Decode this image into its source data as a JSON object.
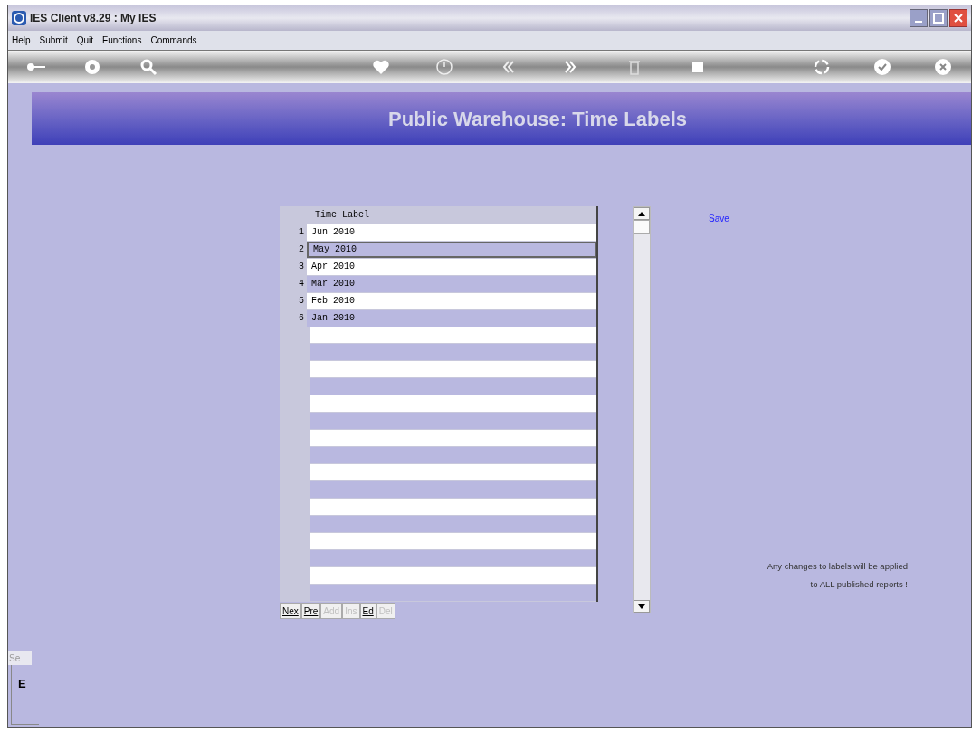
{
  "window": {
    "title": "IES Client v8.29 : My IES"
  },
  "menu": [
    "Help",
    "Submit",
    "Quit",
    "Functions",
    "Commands"
  ],
  "banner": {
    "title": "Public Warehouse: Time Labels"
  },
  "table": {
    "columns": [
      "Time Label"
    ],
    "rows": [
      {
        "number": "1",
        "label": "Jun 2010",
        "selected": false
      },
      {
        "number": "2",
        "label": "May 2010",
        "selected": true
      },
      {
        "number": "3",
        "label": "Apr 2010",
        "selected": false
      },
      {
        "number": "4",
        "label": "Mar 2010",
        "selected": false
      },
      {
        "number": "5",
        "label": "Feb 2010",
        "selected": false
      },
      {
        "number": "6",
        "label": "Jan 2010",
        "selected": false
      }
    ]
  },
  "nav_buttons": [
    {
      "label": "Nex",
      "disabled": false
    },
    {
      "label": "Pre",
      "disabled": false
    },
    {
      "label": "Add",
      "disabled": true
    },
    {
      "label": "Ins",
      "disabled": true
    },
    {
      "label": "Ed",
      "disabled": false
    },
    {
      "label": "Del",
      "disabled": true
    }
  ],
  "save_link": "Save",
  "note": [
    "Any changes to labels will be applied",
    "to ALL published reports !"
  ],
  "side_tab": {
    "label": "Se",
    "value": "E"
  }
}
